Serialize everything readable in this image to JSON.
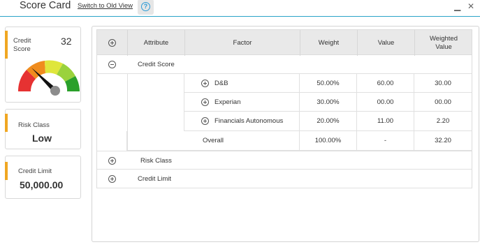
{
  "header": {
    "title": "Score Card",
    "old_view_link": "Switch to Old View",
    "help_icon": "?",
    "minimize": "▁",
    "close": "✕"
  },
  "cards": {
    "credit_score": {
      "label": "Credit Score",
      "value": "32",
      "gauge_colors": [
        "#e63232",
        "#f08c1e",
        "#dfe63c",
        "#9ad23c",
        "#2aa02a"
      ]
    },
    "risk_class": {
      "label": "Risk Class",
      "value": "Low"
    },
    "credit_limit": {
      "label": "Credit Limit",
      "value": "50,000.00"
    }
  },
  "table": {
    "columns": [
      "Attribute",
      "Factor",
      "Weight",
      "Value",
      "Weighted Value"
    ],
    "groups": [
      {
        "attribute": "Credit Score",
        "expanded": true,
        "rows": [
          {
            "factor": "D&B",
            "weight": "50.00%",
            "value": "60.00",
            "weighted": "30.00"
          },
          {
            "factor": "Experian",
            "weight": "30.00%",
            "value": "00.00",
            "weighted": "00.00"
          },
          {
            "factor": "Financials Autonomous",
            "weight": "20.00%",
            "value": "11.00",
            "weighted": "2.20"
          }
        ],
        "overall": {
          "label": "Overall",
          "weight": "100.00%",
          "value": "-",
          "weighted": "32.20"
        }
      },
      {
        "attribute": "Risk Class",
        "expanded": false
      },
      {
        "attribute": "Credit Limit",
        "expanded": false
      }
    ]
  }
}
